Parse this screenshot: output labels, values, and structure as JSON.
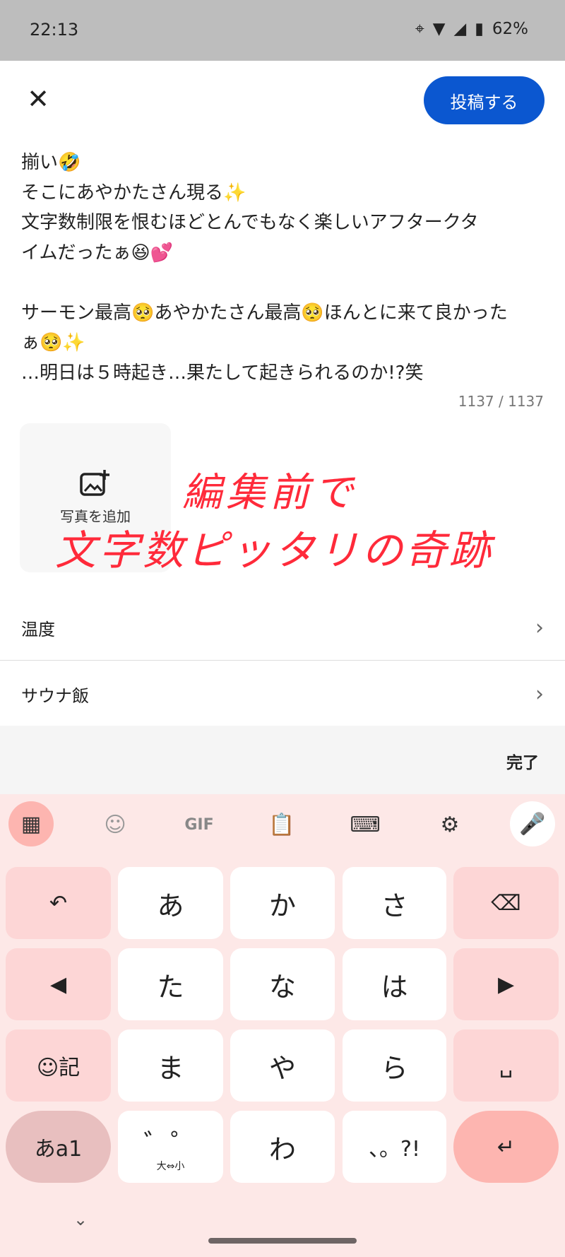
{
  "status_bar": {
    "time": "22:13",
    "battery": "62%",
    "icons": [
      "location-icon",
      "wifi-icon",
      "signal-icon",
      "battery-icon"
    ]
  },
  "header": {
    "close_icon": "close-icon",
    "post_label": "投稿する"
  },
  "post_text_lines": [
    "揃い🤣",
    "そこにあやかたさん現る✨",
    "文字数制限を恨むほどとんでもなく楽しいアフタークタ",
    "イムだったぁ😆💕",
    "",
    "サーモン最高🥺あやかたさん最高🥺ほんとに来て良かった",
    "ぁ🥺✨",
    "…明日は５時起き…果たして起きられるのか!?笑"
  ],
  "char_counter": "1137 / 1137",
  "photo": {
    "label": "写真を追加",
    "icon": "add-photo-icon"
  },
  "annotation": {
    "line1": "編集前で",
    "line2": "文字数ピッタリの奇跡",
    "color": "#ff2a3a"
  },
  "rows": [
    {
      "label": "温度"
    },
    {
      "label": "サウナ飯"
    }
  ],
  "done_label": "完了",
  "keyboard": {
    "toolbar": [
      "apps-icon",
      "sticker-icon",
      "GIF",
      "clipboard-icon",
      "keyboard-icon",
      "settings-icon",
      "mic-icon"
    ],
    "keys": [
      [
        "↶",
        "あ",
        "か",
        "さ",
        "⌫"
      ],
      [
        "◀",
        "た",
        "な",
        "は",
        "▶"
      ],
      [
        "☺記",
        "ま",
        "や",
        "ら",
        "␣"
      ],
      [
        "あa1",
        "゛゜",
        "わ",
        "、。?!",
        "↵"
      ]
    ],
    "dakuten_sub": "大⇔小"
  },
  "colors": {
    "accent": "#0b57d0",
    "keyboard_bg": "#fde8e7",
    "fn_key": "#fdd6d6",
    "enter_key": "#fdb5b0"
  }
}
